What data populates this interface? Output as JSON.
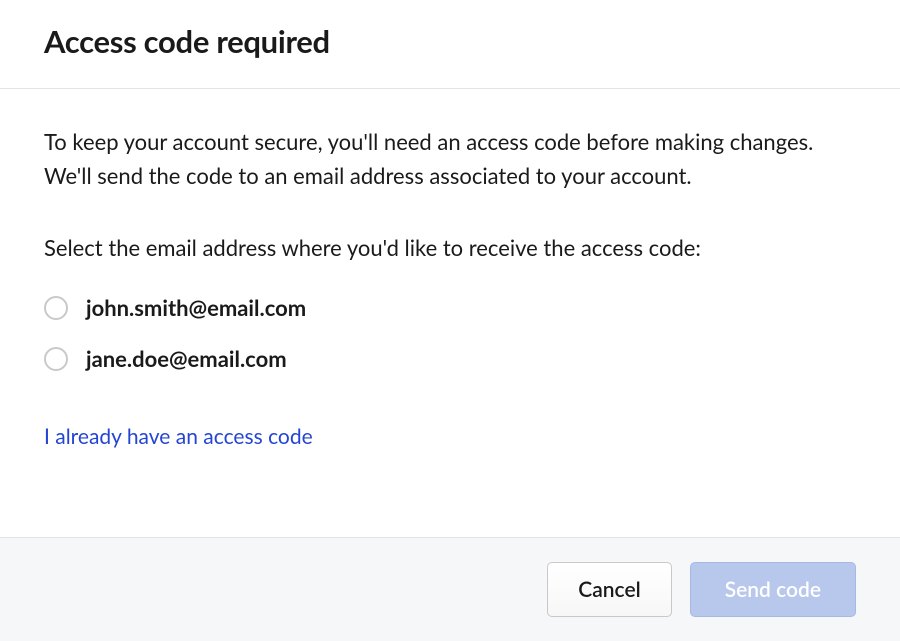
{
  "dialog": {
    "title": "Access code required",
    "intro": "To keep your account secure, you'll need an access code before making changes. We'll send the code to an email address associated to your account.",
    "select_prompt": "Select the email address where you'd like to receive the access code:",
    "emails": [
      "john.smith@email.com",
      "jane.doe@email.com"
    ],
    "already_have_link": "I already have an access code",
    "cancel_label": "Cancel",
    "send_label": "Send code"
  }
}
